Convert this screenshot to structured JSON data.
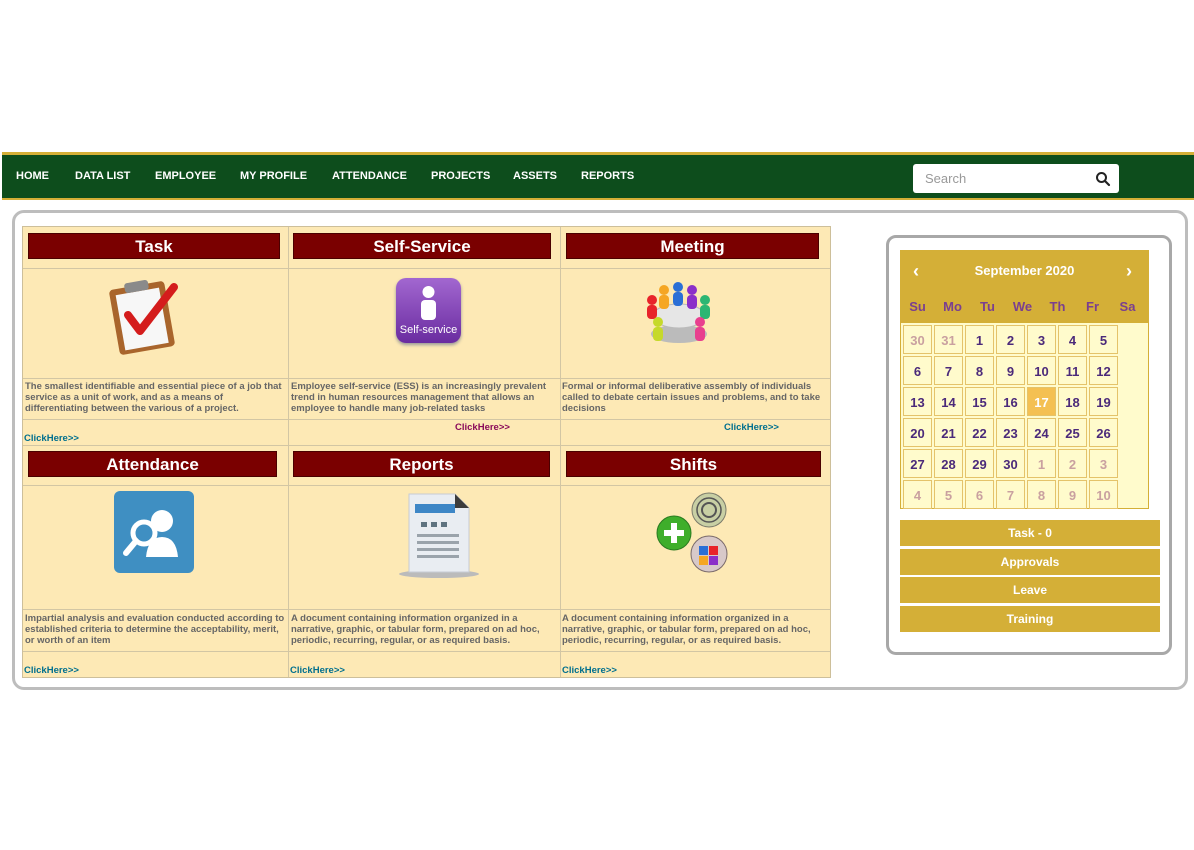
{
  "nav": {
    "items": [
      "HOME",
      "DATA LIST",
      "EMPLOYEE",
      "MY PROFILE",
      "ATTENDANCE",
      "PROJECTS",
      "ASSETS",
      "REPORTS"
    ],
    "search_placeholder": "Search",
    "search_icon": "search-icon"
  },
  "cards": [
    {
      "title": "Task",
      "icon": "clipboard-check-icon",
      "desc": "The smallest identifiable and essential piece of a job that service as a unit of work, and as a means of differentiating between the various  of a project.",
      "link": "ClickHere>>"
    },
    {
      "title": "Self-Service",
      "icon": "self-service-icon",
      "icon_label": "Self-service",
      "desc": "Employee self-service (ESS) is an increasingly prevalent trend in human resources management that allows an employee to handle many job-related tasks",
      "link": "ClickHere>>"
    },
    {
      "title": "Meeting",
      "icon": "meeting-icon",
      "desc": "Formal or informal deliberative assembly of individuals called to debate certain issues and problems, and to take decisions",
      "link": "ClickHere>>"
    },
    {
      "title": "Attendance",
      "icon": "user-search-icon",
      "desc": "Impartial analysis and evaluation conducted according to established criteria to determine the acceptability, merit, or worth of an item",
      "link": "ClickHere>>"
    },
    {
      "title": "Reports",
      "icon": "document-icon",
      "desc": "A document containing information organized in a narrative, graphic, or tabular form, prepared on ad hoc, periodic, recurring, regular, or as required basis.",
      "link": "ClickHere>>"
    },
    {
      "title": "Shifts",
      "icon": "shifts-icon",
      "desc": "A document containing information organized in a narrative, graphic, or tabular form, prepared on ad hoc, periodic, recurring, regular, or as required basis.",
      "link": "ClickHere>>"
    }
  ],
  "calendar": {
    "title": "September 2020",
    "prev": "‹",
    "next": "›",
    "days_of_week": [
      "Su",
      "Mo",
      "Tu",
      "We",
      "Th",
      "Fr",
      "Sa"
    ],
    "weeks": [
      [
        {
          "d": "30",
          "o": true
        },
        {
          "d": "31",
          "o": true
        },
        {
          "d": "1"
        },
        {
          "d": "2"
        },
        {
          "d": "3"
        },
        {
          "d": "4"
        },
        {
          "d": "5"
        }
      ],
      [
        {
          "d": "6"
        },
        {
          "d": "7"
        },
        {
          "d": "8"
        },
        {
          "d": "9"
        },
        {
          "d": "10"
        },
        {
          "d": "11"
        },
        {
          "d": "12"
        }
      ],
      [
        {
          "d": "13"
        },
        {
          "d": "14"
        },
        {
          "d": "15"
        },
        {
          "d": "16"
        },
        {
          "d": "17",
          "t": true
        },
        {
          "d": "18"
        },
        {
          "d": "19"
        }
      ],
      [
        {
          "d": "20"
        },
        {
          "d": "21"
        },
        {
          "d": "22"
        },
        {
          "d": "23"
        },
        {
          "d": "24"
        },
        {
          "d": "25"
        },
        {
          "d": "26"
        }
      ],
      [
        {
          "d": "27"
        },
        {
          "d": "28"
        },
        {
          "d": "29"
        },
        {
          "d": "30"
        },
        {
          "d": "1",
          "o": true
        },
        {
          "d": "2",
          "o": true
        },
        {
          "d": "3",
          "o": true
        }
      ],
      [
        {
          "d": "4",
          "o": true
        },
        {
          "d": "5",
          "o": true
        },
        {
          "d": "6",
          "o": true
        },
        {
          "d": "7",
          "o": true
        },
        {
          "d": "8",
          "o": true
        },
        {
          "d": "9",
          "o": true
        },
        {
          "d": "10",
          "o": true
        }
      ]
    ]
  },
  "side_buttons": [
    "Task - 0",
    "Approvals",
    "Leave",
    "Training"
  ],
  "colors": {
    "nav_bg": "#0d4d1c",
    "gold": "#d4af37",
    "title_bg": "#7a0000",
    "card_bg": "#fde9b5"
  }
}
